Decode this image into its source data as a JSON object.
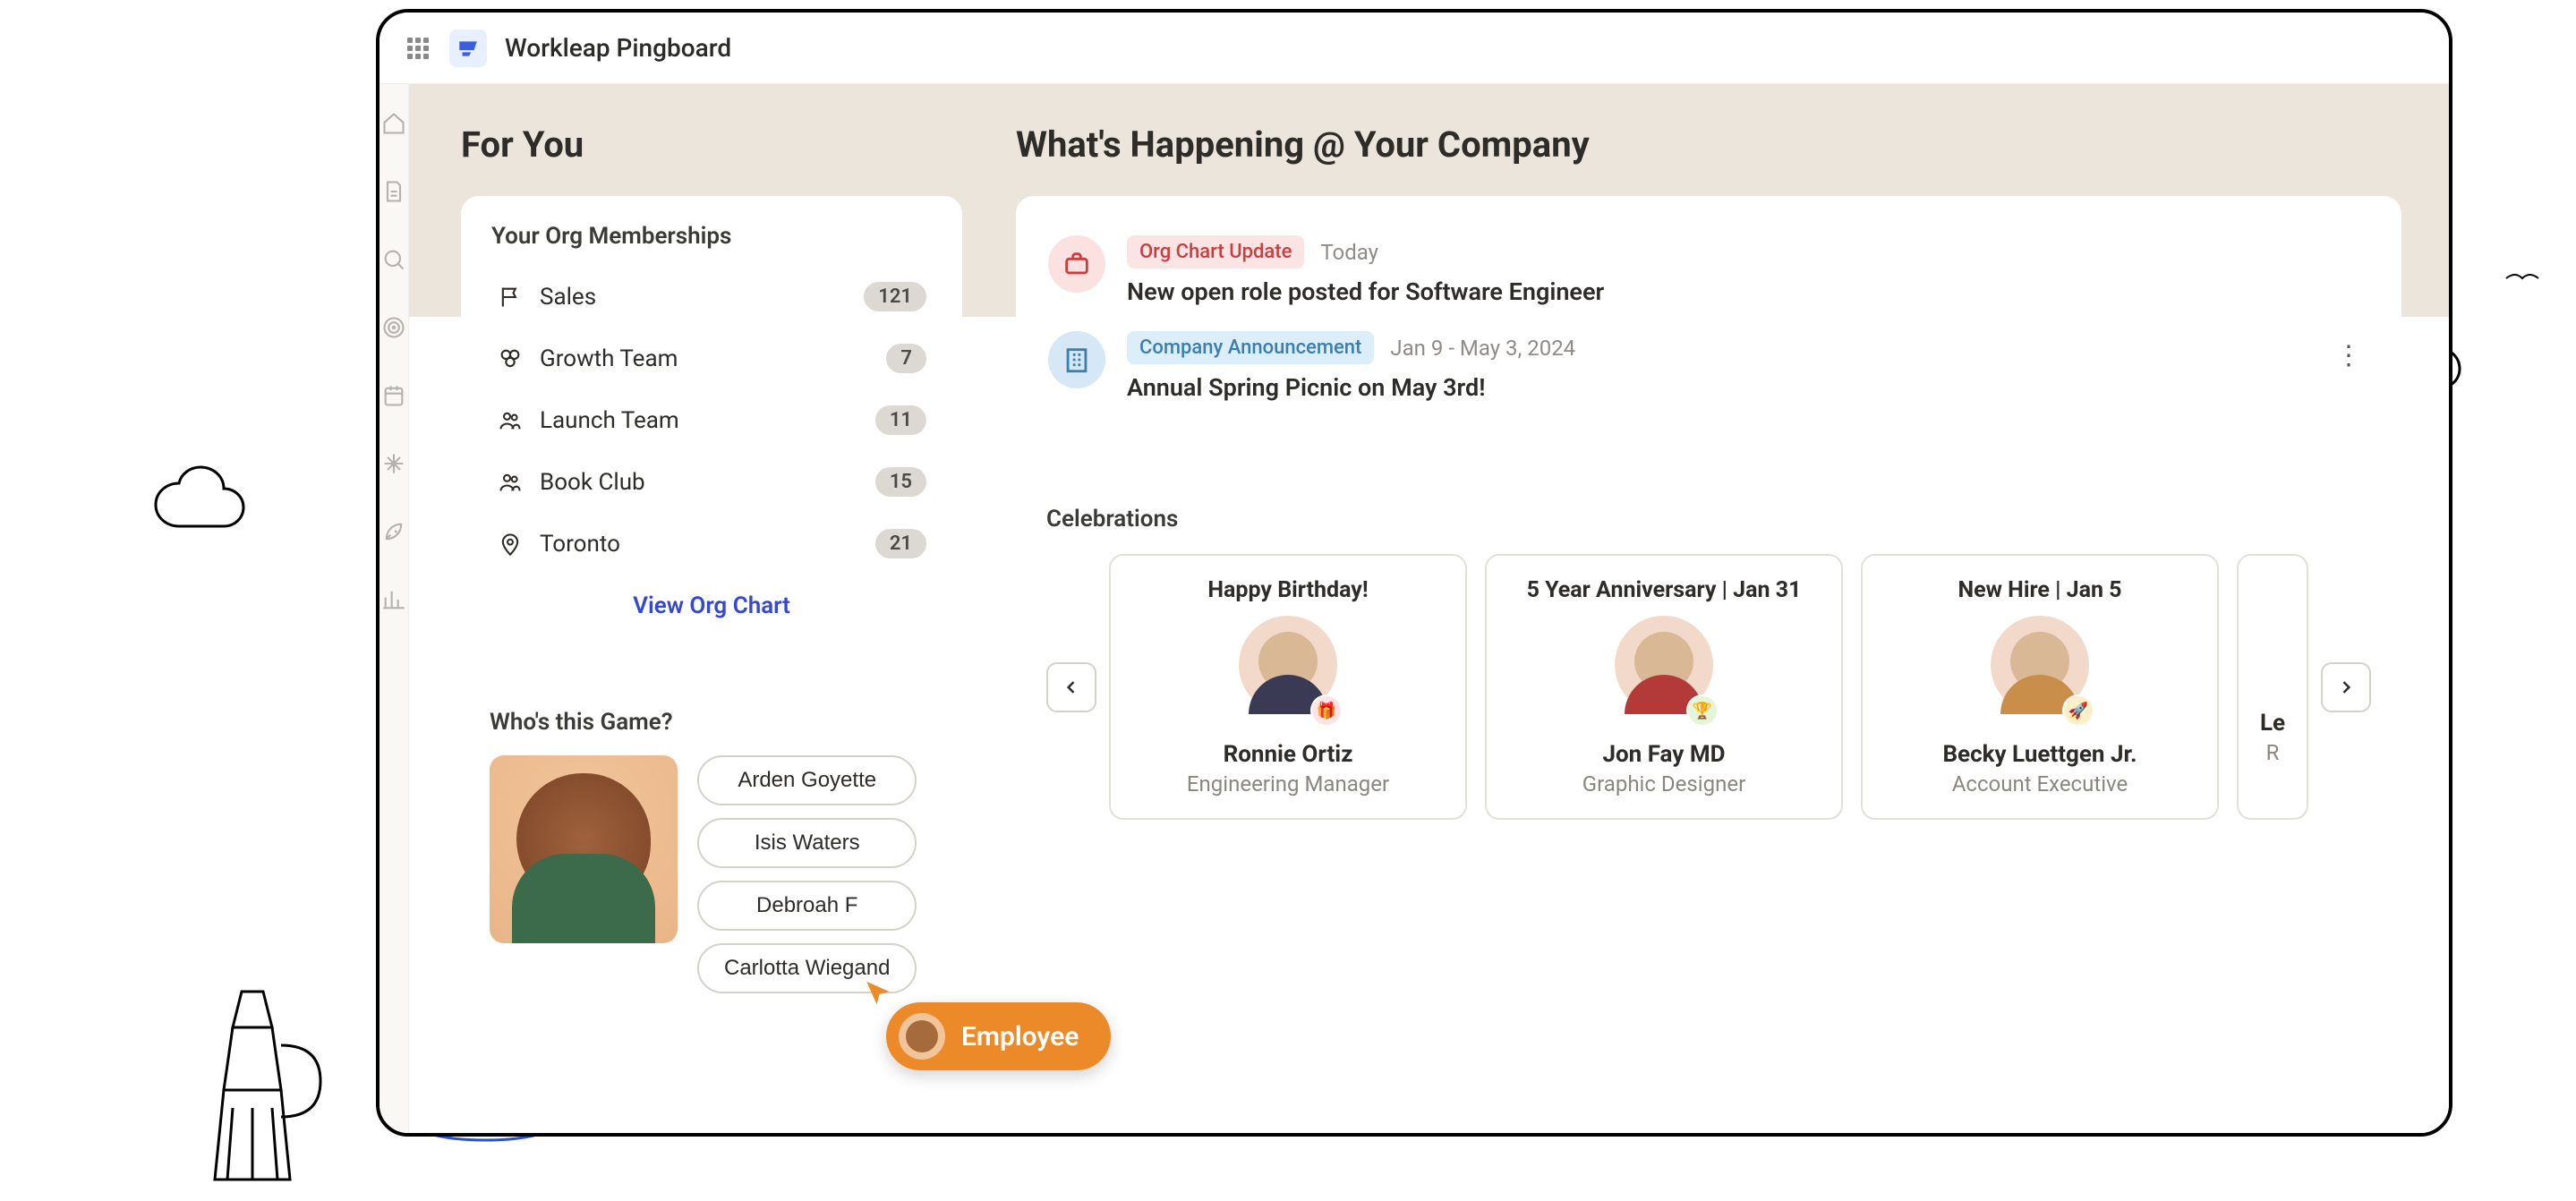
{
  "brand": {
    "name": "Workleap Pingboard"
  },
  "sections": {
    "for_you": "For You",
    "happening": "What's Happening @ Your Company"
  },
  "org_memberships": {
    "title": "Your Org Memberships",
    "items": [
      {
        "label": "Sales",
        "count": "121",
        "icon": "flag"
      },
      {
        "label": "Growth Team",
        "count": "7",
        "icon": "clover"
      },
      {
        "label": "Launch Team",
        "count": "11",
        "icon": "users"
      },
      {
        "label": "Book Club",
        "count": "15",
        "icon": "users"
      },
      {
        "label": "Toronto",
        "count": "21",
        "icon": "pin"
      }
    ],
    "view_link": "View Org Chart"
  },
  "game": {
    "title": "Who's this Game?",
    "options": [
      "Arden Goyette",
      "Isis Waters",
      "Debroah F",
      "Carlotta Wiegand"
    ]
  },
  "feed": [
    {
      "badge": "Org Chart Update",
      "badge_style": "red",
      "date": "Today",
      "title": "New open role posted for Software Engineer",
      "icon": "briefcase",
      "icon_bg": "pink"
    },
    {
      "badge": "Company Announcement",
      "badge_style": "blue",
      "date": "Jan 9 - May 3, 2024",
      "title": "Annual Spring Picnic on May 3rd!",
      "icon": "building",
      "icon_bg": "blue",
      "has_menu": true
    }
  ],
  "celebrations": {
    "title": "Celebrations",
    "items": [
      {
        "heading": "Happy Birthday!",
        "name": "Ronnie Ortiz",
        "role": "Engineering Manager",
        "mini_icon": "🎁"
      },
      {
        "heading": "5 Year Anniversary | Jan 31",
        "name": "Jon Fay MD",
        "role": "Graphic Designer",
        "mini_icon": "🏆"
      },
      {
        "heading": "New Hire | Jan 5",
        "name": "Becky Luettgen Jr.",
        "role": "Account Executive",
        "mini_icon": "🚀"
      }
    ],
    "peek": {
      "name_partial": "Le",
      "role_partial": "R"
    }
  },
  "tooltip": {
    "label": "Employee"
  }
}
